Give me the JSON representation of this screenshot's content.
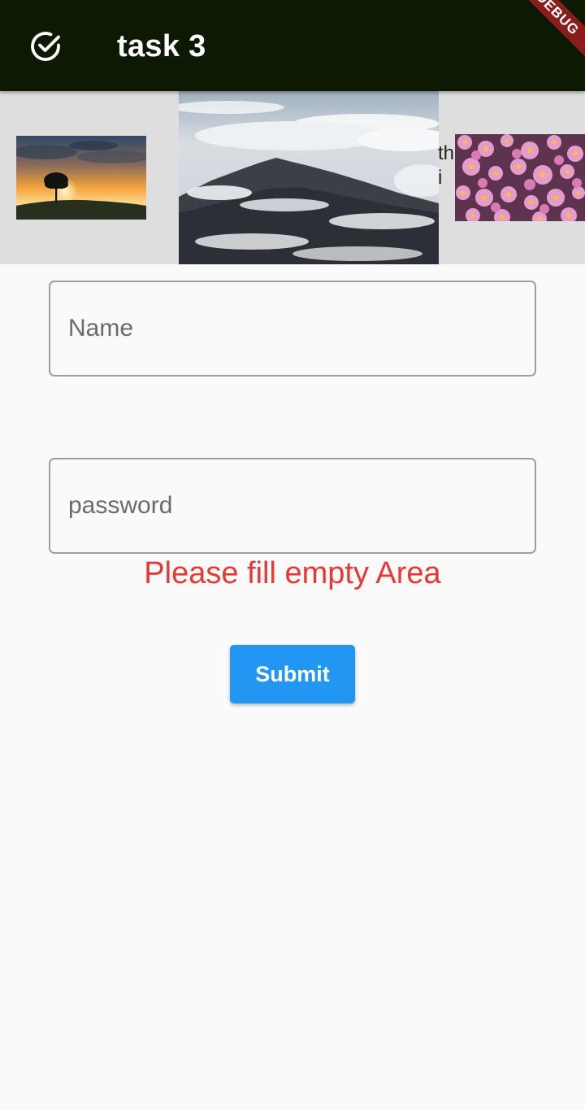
{
  "appbar": {
    "title": "task 3",
    "icon": "check-circle-icon",
    "background": "#0c1a03",
    "debug_banner": "DEBUG"
  },
  "gallery": {
    "background": "#dedede",
    "overflow_text": "thi",
    "images": [
      {
        "subject": "tree at sunset",
        "icon": "sunset-tree-image"
      },
      {
        "subject": "mountain in clouds",
        "icon": "mountain-clouds-image"
      },
      {
        "subject": "pink flowers",
        "icon": "pink-flowers-image"
      }
    ]
  },
  "form": {
    "name_field": {
      "placeholder": "Name",
      "value": ""
    },
    "password_field": {
      "placeholder": "password",
      "value": ""
    },
    "error_message": "Please fill empty Area",
    "error_color": "#e53935",
    "submit_label": "Submit",
    "submit_color": "#2196f3"
  }
}
